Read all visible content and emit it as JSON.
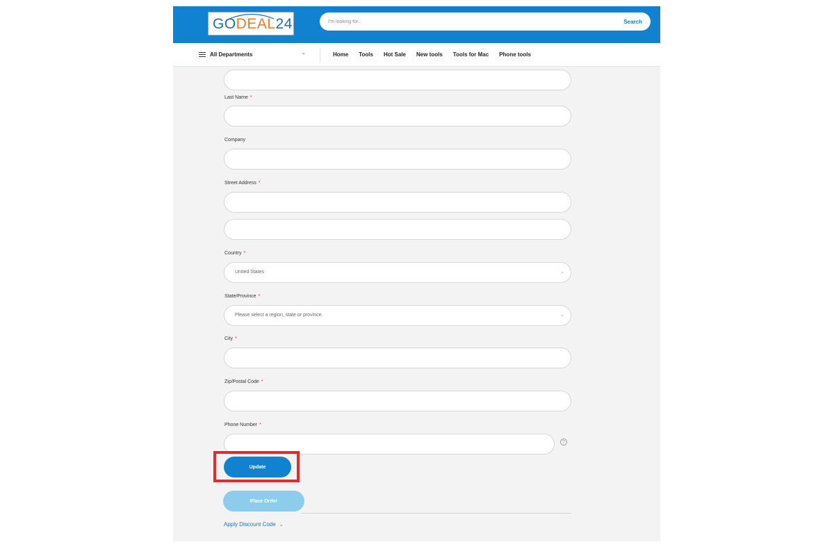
{
  "header": {
    "logo": {
      "part1": "GO",
      "part2": "DEAL",
      "part3": "24"
    },
    "search": {
      "placeholder": "I'm looking for...",
      "button_label": "Search"
    }
  },
  "nav": {
    "departments_label": "All Departments",
    "links": [
      "Home",
      "Tools",
      "Hot Sale",
      "New tools",
      "Tools for Mac",
      "Phone tools"
    ]
  },
  "form": {
    "fields": {
      "last_name": {
        "label": "Last Name",
        "required": "*"
      },
      "company": {
        "label": "Company"
      },
      "street": {
        "label": "Street Address",
        "required": "*"
      },
      "country": {
        "label": "Country",
        "required": "*",
        "value": "United States"
      },
      "state": {
        "label": "State/Province",
        "required": "*",
        "value": "Please select a region, state or province."
      },
      "city": {
        "label": "City",
        "required": "*"
      },
      "zip": {
        "label": "Zip/Postal Code",
        "required": "*"
      },
      "phone": {
        "label": "Phone Number",
        "required": "*",
        "help": "?"
      }
    },
    "buttons": {
      "update": "Update",
      "place_order": "Place Order"
    },
    "discount_link": "Apply Discount Code"
  },
  "colors": {
    "header_blue": "#1082cf",
    "logo_orange": "#f07a21",
    "place_order_disabled": "#8ccdeb",
    "highlight_red": "#e8282f",
    "required_red": "#e02b27"
  }
}
